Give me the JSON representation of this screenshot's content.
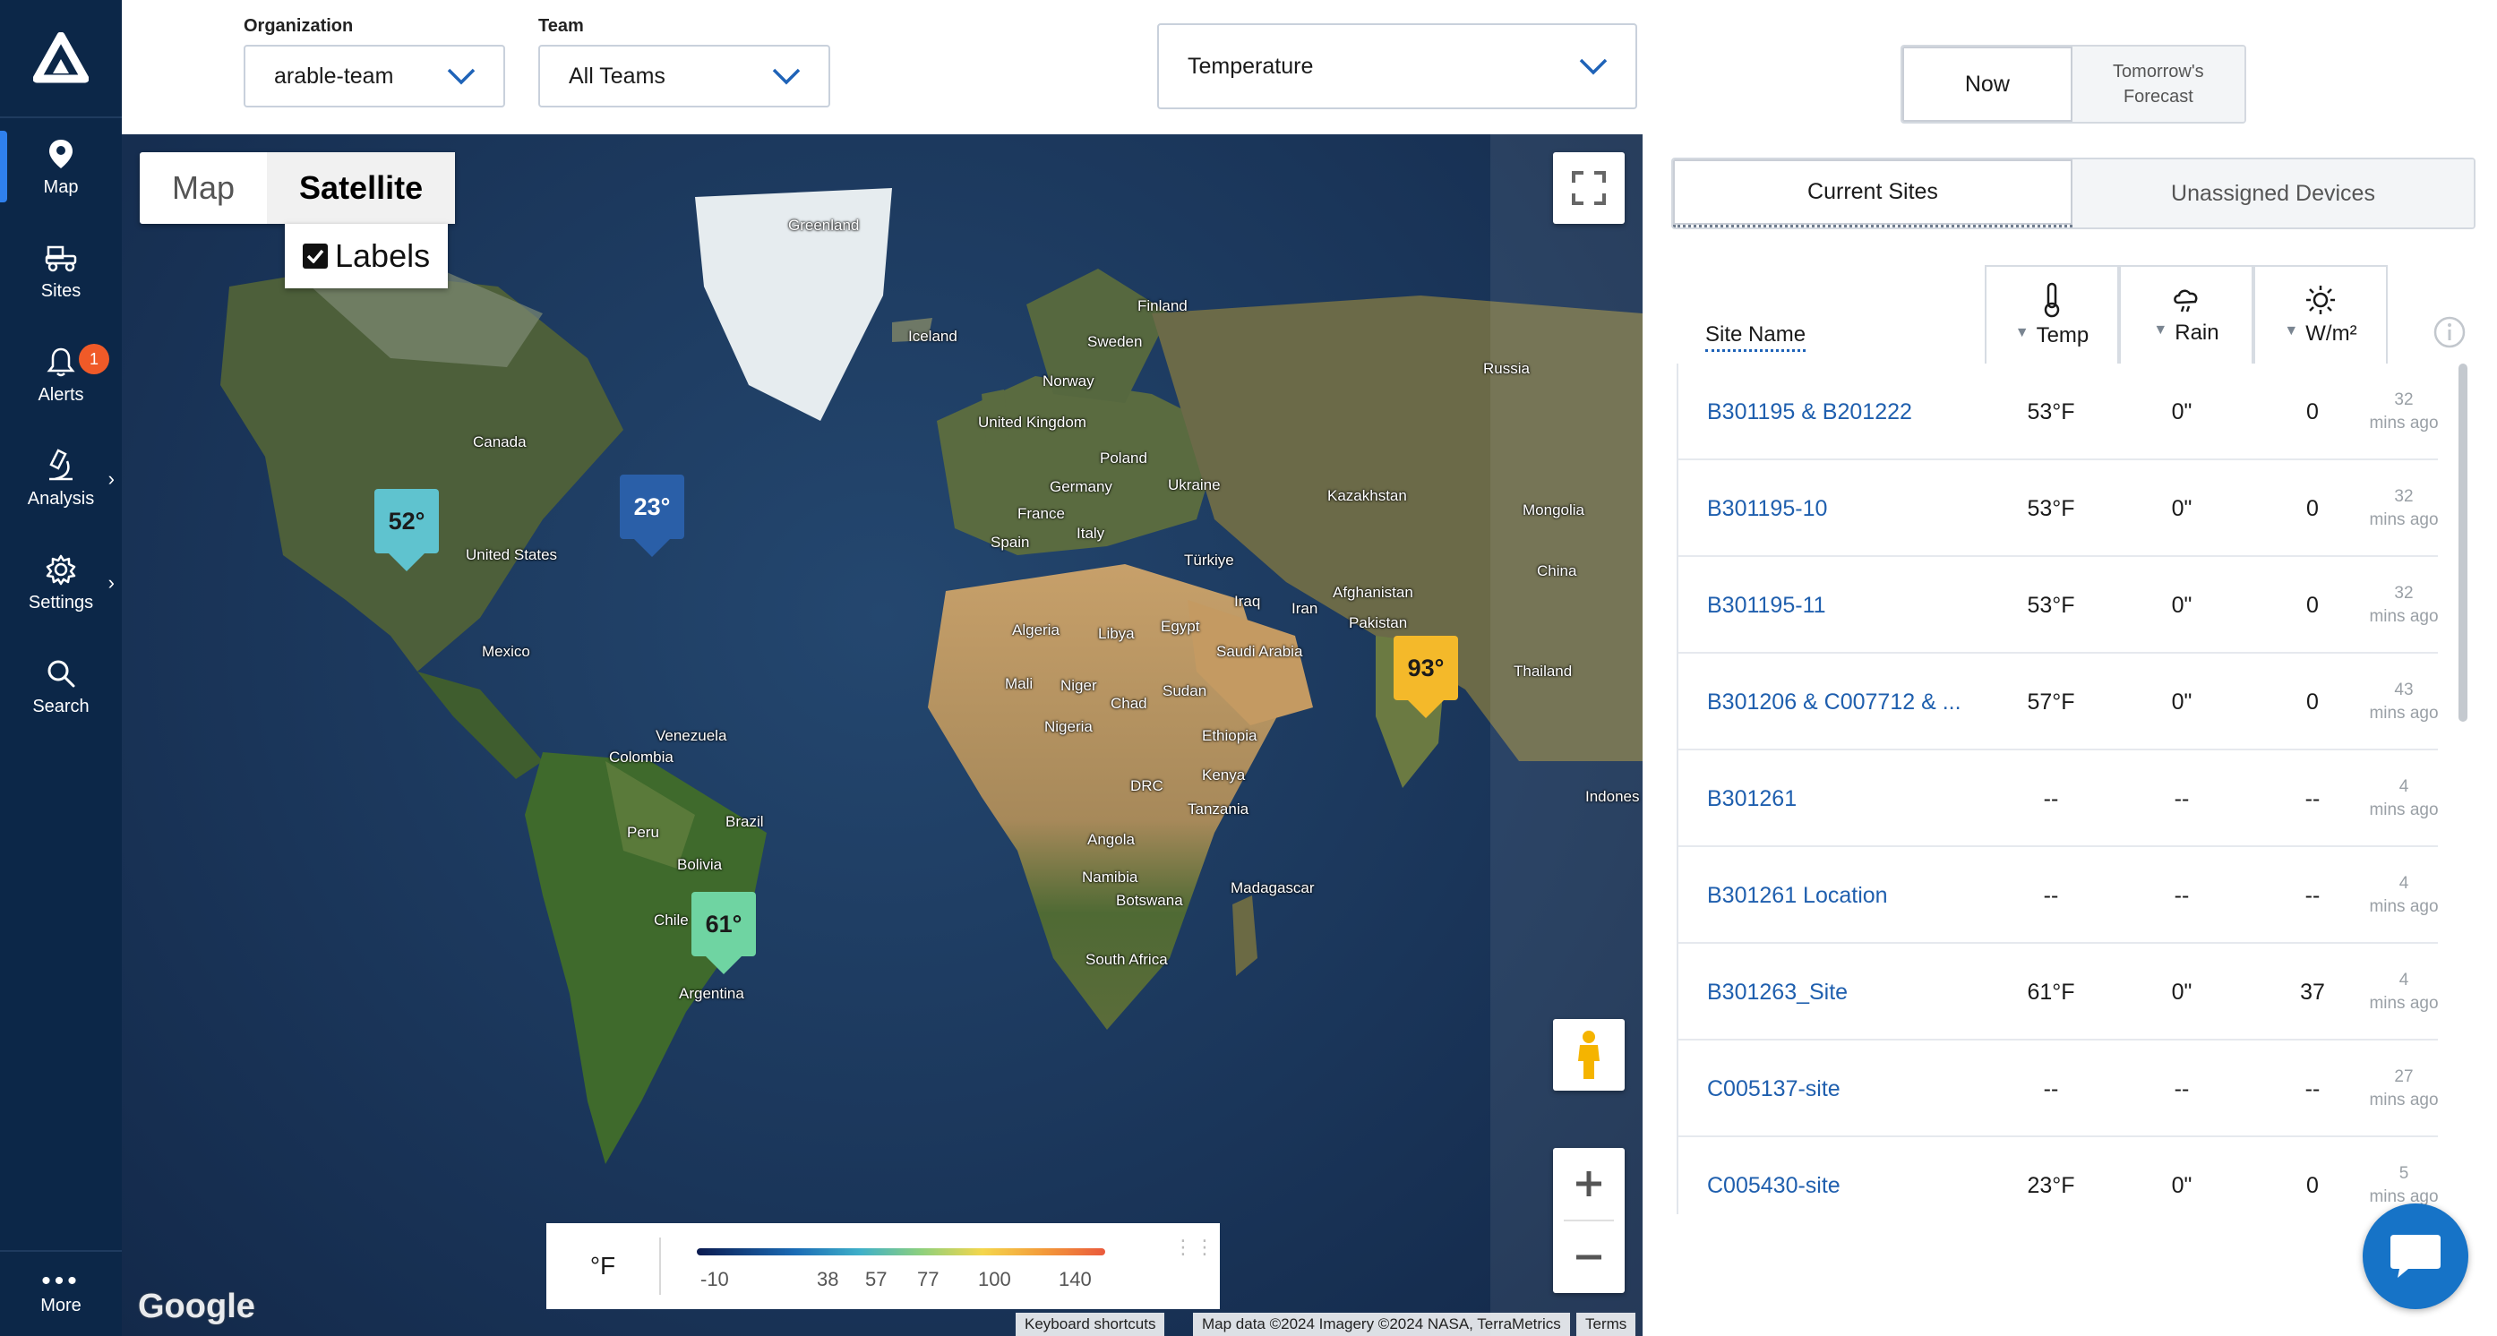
{
  "sidebar": {
    "items": [
      {
        "label": "Map",
        "icon": "map-pin-icon"
      },
      {
        "label": "Sites",
        "icon": "tractor-icon"
      },
      {
        "label": "Alerts",
        "icon": "bell-icon",
        "badge": "1"
      },
      {
        "label": "Analysis",
        "icon": "microscope-icon"
      },
      {
        "label": "Settings",
        "icon": "gear-icon"
      },
      {
        "label": "Search",
        "icon": "search-icon"
      }
    ],
    "more_label": "More"
  },
  "filters": {
    "organization_label": "Organization",
    "organization_value": "arable-team",
    "team_label": "Team",
    "team_value": "All Teams",
    "metric_value": "Temperature"
  },
  "map": {
    "toggle": {
      "map_label": "Map",
      "satellite_label": "Satellite"
    },
    "labels_checkbox": "Labels",
    "countries": [
      "Greenland",
      "Finland",
      "Sweden",
      "Iceland",
      "Norway",
      "Russia",
      "Canada",
      "United Kingdom",
      "Poland",
      "Germany",
      "Ukraine",
      "Kazakhstan",
      "France",
      "Mongolia",
      "Italy",
      "Spain",
      "Türkiye",
      "China",
      "United States",
      "Afghanistan",
      "Iraq",
      "Iran",
      "Pakistan",
      "Algeria",
      "Libya",
      "Egypt",
      "Saudi Arabia",
      "Mexico",
      "Thailand",
      "Mali",
      "Niger",
      "Chad",
      "Sudan",
      "Ethiopia",
      "Venezuela",
      "Nigeria",
      "Colombia",
      "Kenya",
      "DRC",
      "Tanzania",
      "Indones",
      "Brazil",
      "Peru",
      "Angola",
      "Bolivia",
      "Namibia",
      "Madagascar",
      "Botswana",
      "Chile",
      "South Africa",
      "Argentina"
    ],
    "pins": [
      {
        "label": "52°",
        "color": "#5fc3cf"
      },
      {
        "label": "23°",
        "color": "#2a5fa8"
      },
      {
        "label": "93°",
        "color": "#f4b92a"
      },
      {
        "label": "61°",
        "color": "#6fd4a2"
      }
    ],
    "legend": {
      "unit": "°F",
      "ticks": [
        "-10",
        "38",
        "57",
        "77",
        "100",
        "140"
      ]
    },
    "google_logo": "Google",
    "attribution": {
      "shortcuts": "Keyboard shortcuts",
      "data": "Map data ©2024 Imagery ©2024 NASA, TerraMetrics",
      "terms": "Terms"
    }
  },
  "panel": {
    "time_toggle": {
      "now": "Now",
      "forecast": "Tomorrow's Forecast"
    },
    "tabs": {
      "current": "Current Sites",
      "unassigned": "Unassigned Devices"
    },
    "columns": {
      "site": "Site Name",
      "temp": "Temp",
      "rain": "Rain",
      "sun": "W/m²"
    },
    "rows": [
      {
        "name": "B301195 & B201222",
        "temp": "53°F",
        "rain": "0\"",
        "sun": "0",
        "ago_num": "32",
        "ago_unit": "mins ago"
      },
      {
        "name": "B301195-10",
        "temp": "53°F",
        "rain": "0\"",
        "sun": "0",
        "ago_num": "32",
        "ago_unit": "mins ago"
      },
      {
        "name": "B301195-11",
        "temp": "53°F",
        "rain": "0\"",
        "sun": "0",
        "ago_num": "32",
        "ago_unit": "mins ago"
      },
      {
        "name": "B301206 & C007712 & ...",
        "temp": "57°F",
        "rain": "0\"",
        "sun": "0",
        "ago_num": "43",
        "ago_unit": "mins ago"
      },
      {
        "name": "B301261",
        "temp": "--",
        "rain": "--",
        "sun": "--",
        "ago_num": "4",
        "ago_unit": "mins ago"
      },
      {
        "name": "B301261 Location",
        "temp": "--",
        "rain": "--",
        "sun": "--",
        "ago_num": "4",
        "ago_unit": "mins ago"
      },
      {
        "name": "B301263_Site",
        "temp": "61°F",
        "rain": "0\"",
        "sun": "37",
        "ago_num": "4",
        "ago_unit": "mins ago"
      },
      {
        "name": "C005137-site",
        "temp": "--",
        "rain": "--",
        "sun": "--",
        "ago_num": "27",
        "ago_unit": "mins ago"
      },
      {
        "name": "C005430-site",
        "temp": "23°F",
        "rain": "0\"",
        "sun": "0",
        "ago_num": "5",
        "ago_unit": "mins ago"
      }
    ]
  }
}
